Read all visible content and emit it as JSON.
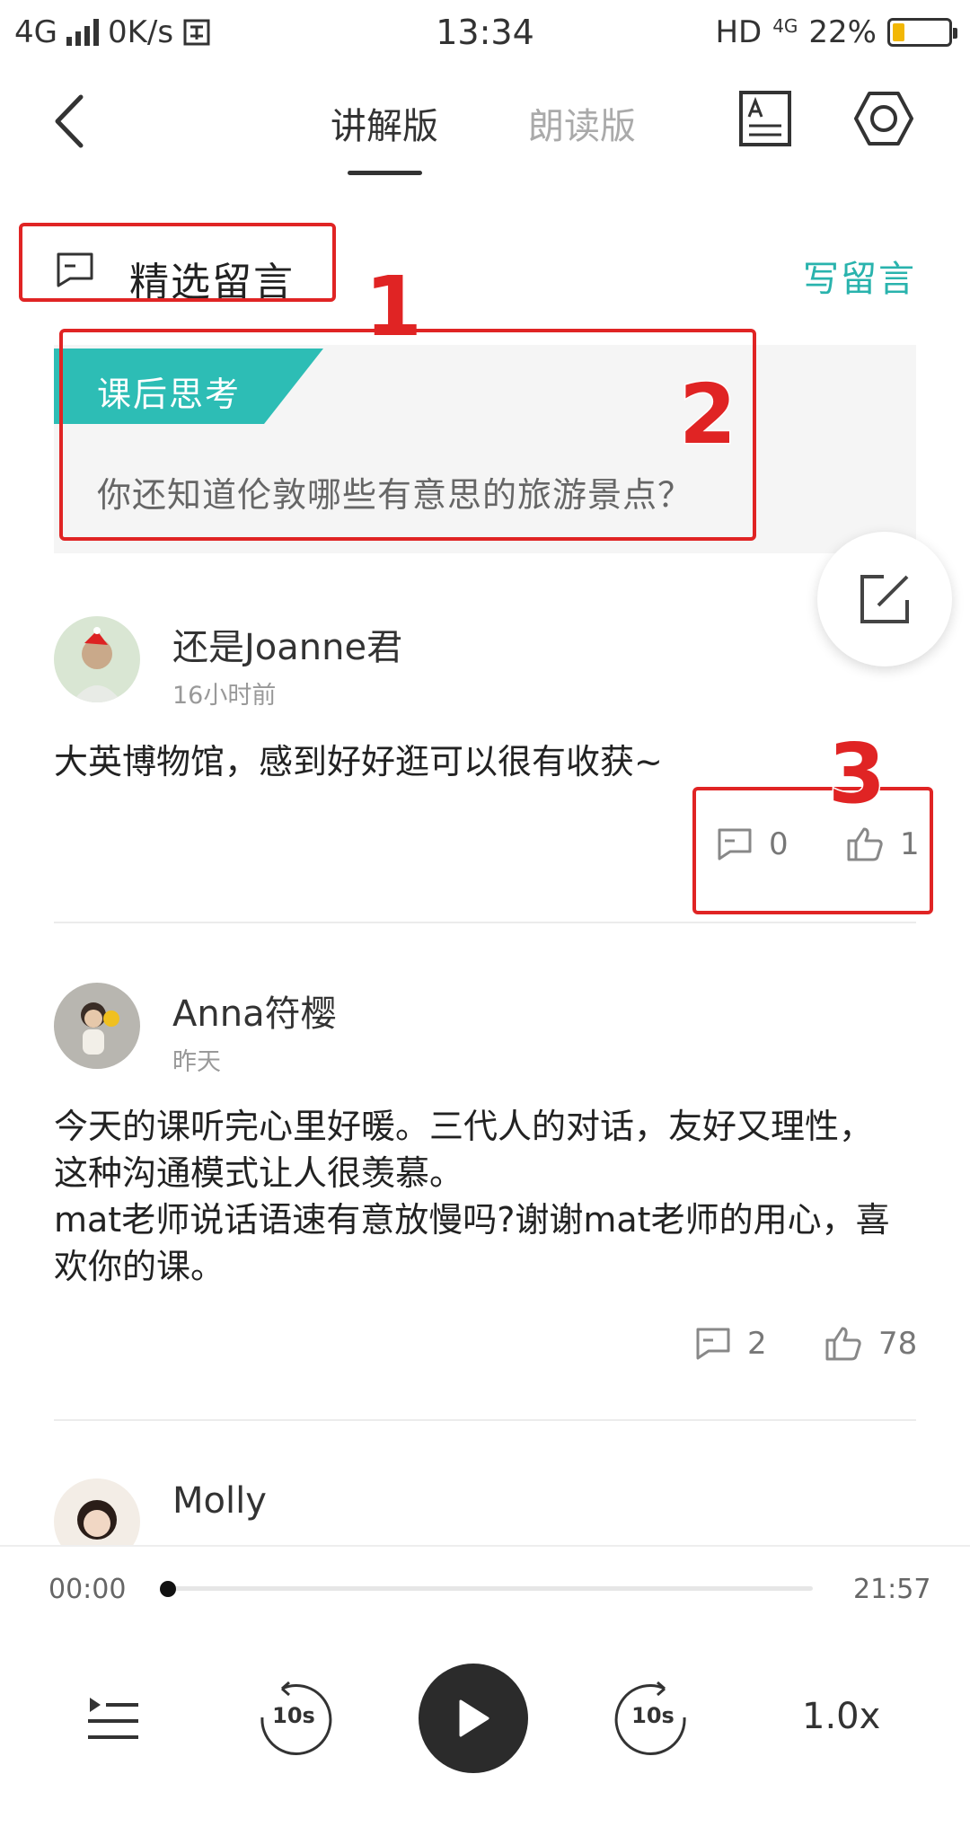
{
  "status_bar": {
    "network": "4G",
    "speed": "0K/s",
    "time": "13:34",
    "hd": "HD",
    "net2": "4G",
    "battery": "22%",
    "battery_level": 0.22
  },
  "header": {
    "tab_active": "讲解版",
    "tab_inactive": "朗读版",
    "icons": [
      "back-icon",
      "font-icon",
      "settings-hex-icon"
    ]
  },
  "section": {
    "title": "精选留言",
    "write_link": "写留言"
  },
  "annotations": [
    "1",
    "2",
    "3"
  ],
  "card": {
    "tag": "课后思考",
    "question": "你还知道伦敦哪些有意思的旅游景点？"
  },
  "comments": [
    {
      "name": "还是Joanne君",
      "time": "16小时前",
      "text": "大英博物馆，感到好好逛可以很有收获~",
      "replies": "0",
      "likes": "1"
    },
    {
      "name": "Anna符樱",
      "time": "昨天",
      "text": "今天的课听完心里好暖。三代人的对话，友好又理性，这种沟通模式让人很羡慕。\nmat老师说话语速有意放慢吗?谢谢mat老师的用心，喜欢你的课。",
      "replies": "2",
      "likes": "78"
    },
    {
      "name": "Molly"
    }
  ],
  "player": {
    "current": "00:00",
    "total": "21:57",
    "progress": 0.0,
    "rewind": "10s",
    "forward": "10s",
    "speed": "1.0x",
    "colors": {
      "accent": "#2dbdb5",
      "annotation": "#e02424"
    }
  }
}
